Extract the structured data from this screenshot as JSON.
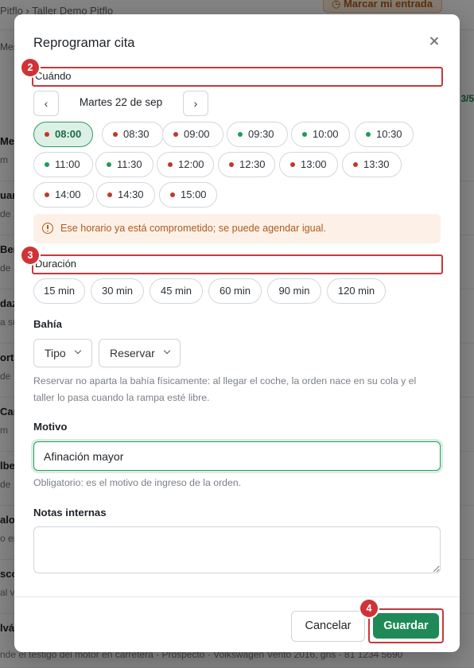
{
  "background": {
    "breadcrumb": "Pitflo › Taller Demo Pitflo",
    "entry_button": "Marcar mi entrada",
    "column_label": "Mes",
    "right_badge": "3/5",
    "rows": [
      {
        "name": "Me",
        "sub": "m"
      },
      {
        "name": "uar",
        "sub": "de"
      },
      {
        "name": "Ber",
        "sub": "de"
      },
      {
        "name": "daz",
        "sub": "a su"
      },
      {
        "name": "orte",
        "sub": "de"
      },
      {
        "name": "Car",
        "sub": "m"
      },
      {
        "name": "lber",
        "sub": "de"
      },
      {
        "name": "alo",
        "sub": "o en"
      },
      {
        "name": "sco",
        "sub": "al vo"
      },
      {
        "name": "lvá",
        "sub": ""
      }
    ],
    "bottom_row": "nde el testigo del motor en carretera · Prospecto · Volkswagen Vento 2016, gris · 81 1234 5690"
  },
  "modal": {
    "title": "Reprogramar cita",
    "when_label": "Cuándo",
    "prev_label": "‹",
    "next_label": "›",
    "date": "Martes 22 de sep",
    "slots": [
      {
        "time": "08:00",
        "status": "taken",
        "selected": true
      },
      {
        "time": "08:30",
        "status": "taken",
        "selected": false
      },
      {
        "time": "09:00",
        "status": "taken",
        "selected": false
      },
      {
        "time": "09:30",
        "status": "available",
        "selected": false
      },
      {
        "time": "10:00",
        "status": "available",
        "selected": false
      },
      {
        "time": "10:30",
        "status": "available",
        "selected": false
      },
      {
        "time": "11:00",
        "status": "available",
        "selected": false
      },
      {
        "time": "11:30",
        "status": "available",
        "selected": false
      },
      {
        "time": "12:00",
        "status": "taken",
        "selected": false
      },
      {
        "time": "12:30",
        "status": "taken",
        "selected": false
      },
      {
        "time": "13:00",
        "status": "taken",
        "selected": false
      },
      {
        "time": "13:30",
        "status": "taken",
        "selected": false
      },
      {
        "time": "14:00",
        "status": "taken",
        "selected": false
      },
      {
        "time": "14:30",
        "status": "taken",
        "selected": false
      },
      {
        "time": "15:00",
        "status": "taken",
        "selected": false
      }
    ],
    "warning": "Ese horario ya está comprometido; se puede agendar igual.",
    "duration_label": "Duración",
    "durations": [
      "15 min",
      "30 min",
      "45 min",
      "60 min",
      "90 min",
      "120 min"
    ],
    "bay_label": "Bahía",
    "bay_type": "Tipo",
    "bay_reserve": "Reservar",
    "bay_help_1": "Reservar no aparta la bahía físicamente: al llegar el coche, la orden nace en su cola y el",
    "bay_help_2": "taller lo pasa cuando la rampa esté libre.",
    "reason_label": "Motivo",
    "reason_value": "Afinación mayor",
    "reason_help": "Obligatorio: es el motivo de ingreso de la orden.",
    "notes_label": "Notas internas",
    "notes_value": "",
    "cancel_label": "Cancelar",
    "save_label": "Guardar"
  },
  "annotations": [
    "2",
    "3",
    "4"
  ],
  "colors": {
    "accent_green": "#1f8a57",
    "selected_bg": "#dcf0e5",
    "taken_dot": "#c0392b",
    "available_dot": "#1e9b5a",
    "warning_text": "#b0591c",
    "warning_bg": "#fdf1e7",
    "annotation_red": "#c8383b"
  }
}
